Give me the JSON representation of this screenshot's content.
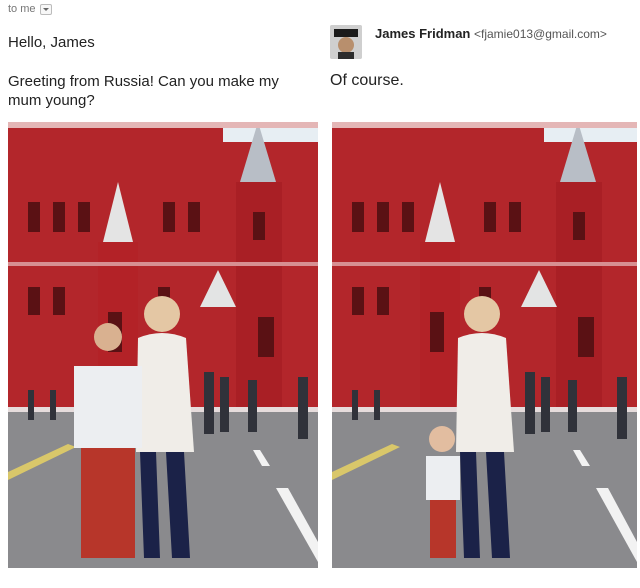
{
  "left": {
    "to_me_label": "to me",
    "greeting": "Hello, James",
    "message": "Greeting from Russia! Can you make my mum young?",
    "photo_icon": "photo-original"
  },
  "right": {
    "sender_name": "James Fridman",
    "sender_email": "<fjamie013@gmail.com>",
    "reply": "Of course.",
    "photo_icon": "photo-edited"
  },
  "colors": {
    "building_red": "#b3262b",
    "sky": "#e7eef3",
    "pavement": "#8a8a8d"
  }
}
